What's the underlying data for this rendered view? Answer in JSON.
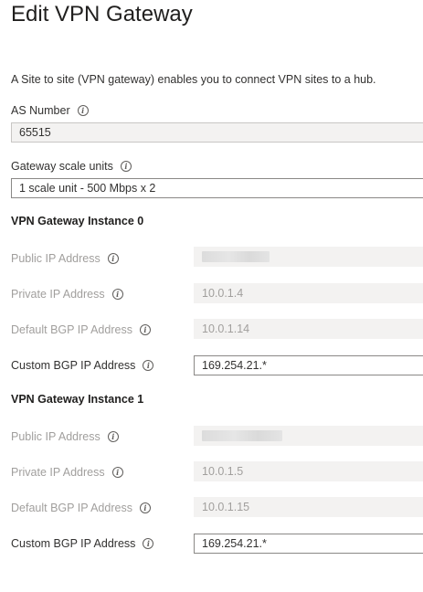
{
  "page": {
    "title": "Edit VPN Gateway"
  },
  "description": "A Site to site (VPN gateway) enables you to connect VPN sites to a hub.",
  "as_number": {
    "label": "AS Number",
    "value": "65515"
  },
  "scale_units": {
    "label": "Gateway scale units",
    "value": "1 scale unit - 500 Mbps x 2"
  },
  "instances": [
    {
      "heading": "VPN Gateway Instance 0",
      "public_ip": {
        "label": "Public IP Address",
        "value": ""
      },
      "private_ip": {
        "label": "Private IP Address",
        "value": "10.0.1.4"
      },
      "default_bgp": {
        "label": "Default BGP IP Address",
        "value": "10.0.1.14"
      },
      "custom_bgp": {
        "label": "Custom BGP IP Address",
        "value": "169.254.21.*"
      }
    },
    {
      "heading": "VPN Gateway Instance 1",
      "public_ip": {
        "label": "Public IP Address",
        "value": ""
      },
      "private_ip": {
        "label": "Private IP Address",
        "value": "10.0.1.5"
      },
      "default_bgp": {
        "label": "Default BGP IP Address",
        "value": "10.0.1.15"
      },
      "custom_bgp": {
        "label": "Custom BGP IP Address",
        "value": "169.254.21.*"
      }
    }
  ],
  "icons": {
    "info": "info-circle-icon"
  },
  "colors": {
    "disabled_text": "#a19f9d",
    "field_bg": "#f3f2f1",
    "border": "#8a8886"
  }
}
